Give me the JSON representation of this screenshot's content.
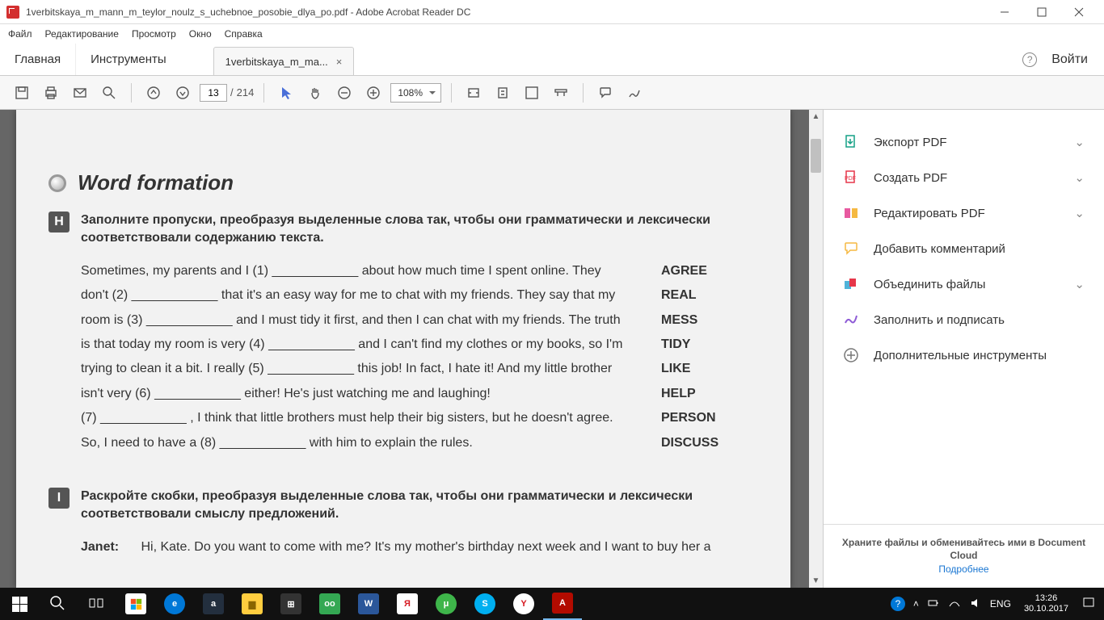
{
  "window": {
    "title": "1verbitskaya_m_mann_m_teylor_noulz_s_uchebnoe_posobie_dlya_po.pdf - Adobe Acrobat Reader DC"
  },
  "menu": {
    "file": "Файл",
    "edit": "Редактирование",
    "view": "Просмотр",
    "window": "Окно",
    "help": "Справка"
  },
  "tabs": {
    "home": "Главная",
    "tools": "Инструменты",
    "doc": "1verbitskaya_m_ma...",
    "login": "Войти"
  },
  "toolbar": {
    "page_current": "13",
    "page_total": "214",
    "zoom": "108%"
  },
  "side": {
    "export": "Экспорт PDF",
    "create": "Создать PDF",
    "editpdf": "Редактировать PDF",
    "comment": "Добавить комментарий",
    "combine": "Объединить файлы",
    "fillsign": "Заполнить и подписать",
    "moretools": "Дополнительные инструменты",
    "cloud_text": "Храните файлы и обменивайтесь ими в Document Cloud",
    "cloud_link": "Подробнее"
  },
  "doc": {
    "section": "Word formation",
    "exH_letter": "H",
    "exH_instr": "Заполните пропуски, преобразуя выделенные слова так, чтобы они грамматически и лексически соответствовали содержанию текста.",
    "exH_text": "Sometimes, my parents and I (1) ____________ about how much time I spent online. They don't (2) ____________ that it's an easy way for me to chat with my friends. They say that my room is (3) ____________ and I must tidy it first, and then I can chat with my friends. The truth is that today my room is very (4) ____________ and I can't find my clothes or my books, so I'm trying to clean it a bit. I really (5) ____________ this job! In fact, I hate it! And my little brother isn't very (6) ____________ either! He's just watching me and laughing!\n(7) ____________ , I think that little brothers must help their big sisters, but he doesn't agree. So, I need to have a (8) ____________ with him to explain the rules.",
    "exH_words": [
      "AGREE",
      "REAL",
      "MESS",
      "TIDY",
      "LIKE",
      "HELP",
      "PERSON",
      "DISCUSS"
    ],
    "exI_letter": "I",
    "exI_instr": "Раскройте скобки, преобразуя выделенные слова так, чтобы они грамматически и лексически соответствовали смыслу предложений.",
    "exI_speaker": "Janet:",
    "exI_line": "Hi, Kate. Do you want to come with me? It's my mother's birthday next week and I want to buy her a"
  },
  "tray": {
    "lang": "ENG",
    "time": "13:26",
    "date": "30.10.2017"
  }
}
